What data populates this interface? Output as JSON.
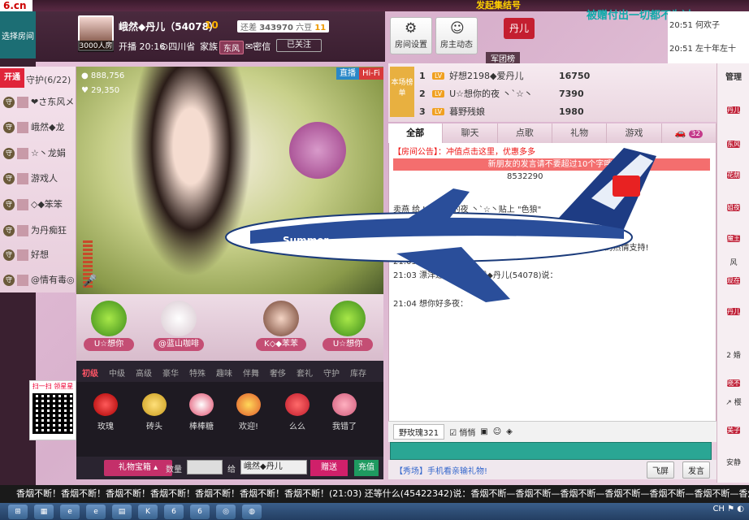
{
  "topbar": {
    "logo": "6.cn",
    "flag": "发起集结号",
    "user": "(54078)",
    "tagline": "被赠付出一切都不为过"
  },
  "leftnav": {
    "select_room": "选择房间"
  },
  "host": {
    "name": "峨然◆丹儿（54078）",
    "lv": "10",
    "fans": "3000人房",
    "open_time": "开播 20:16",
    "location": "四川省",
    "family": "家族",
    "family_tag": "东风",
    "mail": "密信",
    "follow": "已关注",
    "rank_label": "还差",
    "rank_value": "343970",
    "rank_target": "六豆",
    "rank_after": "11"
  },
  "tools": {
    "settings": "房间设置",
    "news": "房主动态",
    "badge": "丹儿",
    "army": "军团榜"
  },
  "guard": {
    "tab": "开通",
    "title": "守护(6/22)",
    "items": [
      "❤さ东风メ",
      "峨然◆龙",
      "☆丶龙娟",
      "游戏人",
      "◇◆笨笨",
      "为丹痴狂",
      "好想",
      "@情有毒◎"
    ]
  },
  "video": {
    "wealth": "888,756",
    "likes": "29,350",
    "live": "直播",
    "hifi": "Hi-Fi"
  },
  "seats": [
    "U☆想你",
    "@蓝山咖啡",
    "K◇◆苯苯",
    "U☆想你"
  ],
  "gift_tabs": [
    "初级",
    "中级",
    "高级",
    "豪华",
    "特殊",
    "趣味",
    "伴舞",
    "奢侈",
    "套礼",
    "守护",
    "库存"
  ],
  "gifts": [
    "玫瑰",
    "砖头",
    "棒棒糖",
    "欢迎!",
    "么么",
    "我错了"
  ],
  "giftbar": {
    "box": "礼物宝箱",
    "qty_label": "数量",
    "to_label": "给",
    "to_name": "峨然◆丹儿",
    "give": "赠送",
    "recharge": "充值"
  },
  "qr": {
    "label": "扫一扫 领星星"
  },
  "ranking": {
    "badge": "本场榜单",
    "rows": [
      {
        "n": "1",
        "name": "好想2198◆爱丹儿",
        "val": "16750"
      },
      {
        "n": "2",
        "name": "U☆想你的夜 丶`☆丶",
        "val": "7390"
      },
      {
        "n": "3",
        "name": "暮野残娘",
        "val": "1980"
      }
    ]
  },
  "chat": {
    "tabs": [
      "全部",
      "聊天",
      "点歌",
      "礼物",
      "游戏"
    ],
    "count": "32",
    "announce": "【房间公告】：冲值点击这里，优惠多多",
    "warn": "新朋友的发言请不要超过10个字哦!",
    "code": "8532290",
    "lines": [
      "卖燕 给 U☆想你的夜 丶`☆丶贴上 \"色狼\"",
      "21:03 来 同 峨然◆丹儿 送 飞机，共1个，感谢 峨◇◆苯苯 的热情支持!",
      "21:03 欢迎 进入房间",
      "21:03 漂洋过海出国  峨然◆丹儿(54078)说：",
      "21:04 想你好多夜："
    ],
    "input_name": "野玫瑰321",
    "whisper": "悄悄",
    "showroom": "【秀场】手机看亲输礼物!",
    "fly": "飞屏",
    "send": "发言"
  },
  "rightcol": {
    "title": "管理",
    "items": [
      "丹儿",
      "东风",
      "花荫",
      "姐夜",
      "魔王",
      "风",
      "现在",
      "丹儿",
      "2 婚",
      "晓不",
      "↗ 樱",
      "美子",
      "安静"
    ],
    "times": [
      "20:51",
      "20:51"
    ],
    "msgs": [
      "何欢子",
      "左十年左十"
    ]
  },
  "marquee": "香烟不断！香烟不断！香烟不断！香烟不断！香烟不断！香烟不断！香烟不断！(21:03)    还等什么(45422342)说：香烟不断—香烟不断—香烟不断—香烟不断—香烟不断—香烟不断—香烟不断—香烟不断"
}
